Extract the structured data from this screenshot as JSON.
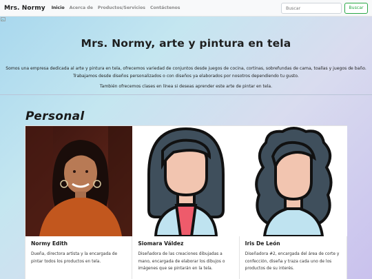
{
  "navbar": {
    "brand": "Mrs. Normy",
    "links": [
      "Inicio",
      "Acerca de",
      "Productos/Servicios",
      "Contáctenos"
    ],
    "search_placeholder": "Buscar",
    "search_button": "Buscar"
  },
  "hero": {
    "title": "Mrs. Normy, arte y pintura en tela",
    "description": "Somos una empresa dedicada al arte y pintura en tela, ofrecemos variedad de conjuntos desde juegos de cocina, cortinas, sobrefundas de cama, toallas y juegos de baño. Trabajamos desde diseños personalizados o con diseños ya elaborados por nosotros dependiendo tu gusto.",
    "note": "También ofrecemos clases en línea si deseas aprender este arte de pintar en tela."
  },
  "personal": {
    "title": "Personal",
    "cards": [
      {
        "name": "Normy Edith",
        "text": "Dueña, directora artista y la encargada de pintar todos los productos en tela."
      },
      {
        "name": "Siomara Váldez",
        "text": "Diseñadora de las creaciones dibujadas a mano, encargada de elaborar los dibujos o imágenes que se pintarán en la tela."
      },
      {
        "name": "Iris De León",
        "text": "Diseñadora #2, encargada del área de corte y confección, diseña y traza cada uno de los productos de su interés."
      }
    ]
  },
  "colors": {
    "accent": "#28a745",
    "navbar_bg": "#f8f9fa"
  }
}
